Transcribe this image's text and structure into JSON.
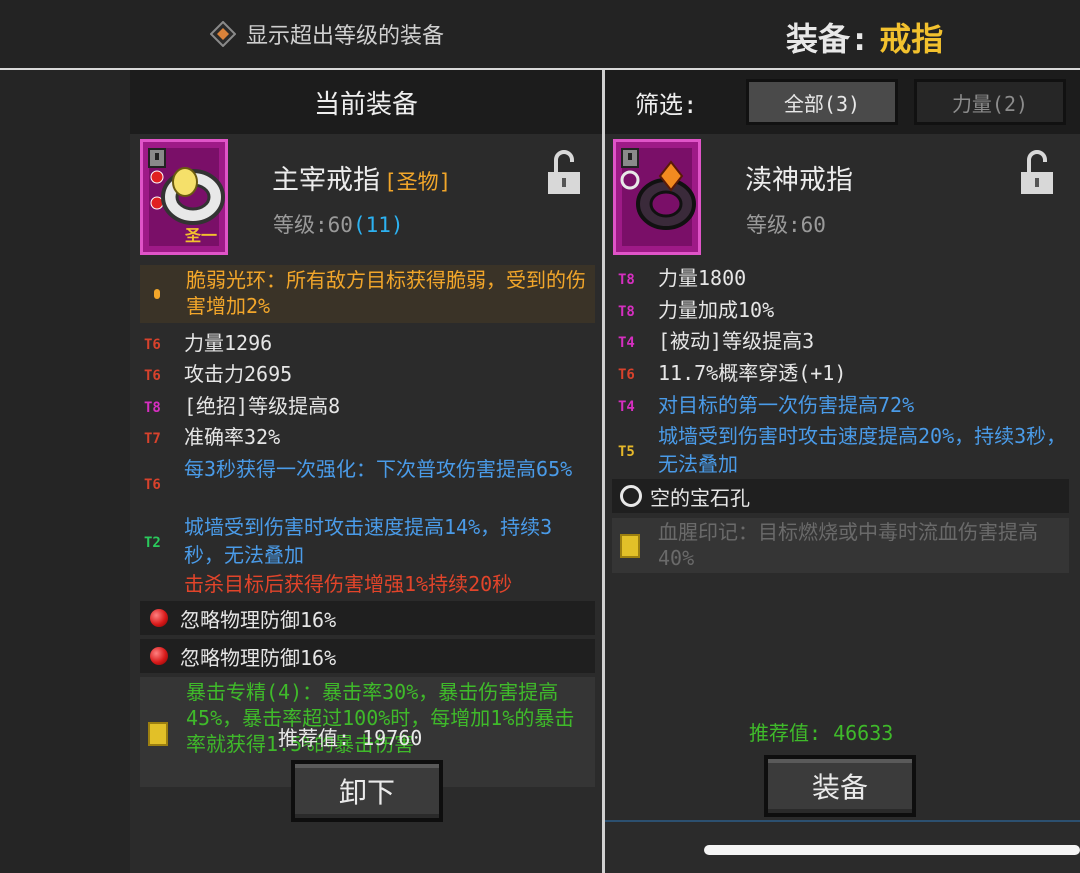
{
  "top": {
    "show_toggle_label": "显示超出等级的装备",
    "equip_label": "装备:",
    "equip_value": "戒指"
  },
  "left": {
    "header": "当前装备",
    "item": {
      "name": "主宰戒指",
      "tag": "[圣物]",
      "icon_badge": "圣一",
      "level_label": "等级:60",
      "level_bonus": "(11)"
    },
    "aura": "脆弱光环：所有敌方目标获得脆弱，受到的伤害增加2%",
    "stats": [
      {
        "tier": "T6",
        "text": "力量1296"
      },
      {
        "tier": "T6",
        "text": "攻击力2695"
      },
      {
        "tier": "T8",
        "text": "[绝招]等级提高8"
      },
      {
        "tier": "T7",
        "text": "准确率32%"
      },
      {
        "tier": "T6",
        "text": "每3秒获得一次强化：下次普攻伤害提高65%"
      },
      {
        "tier": "T2",
        "text": "城墙受到伤害时攻击速度提高14%，持续3秒，无法叠加"
      }
    ],
    "red_line": "击杀目标后获得伤害增强1%持续20秒",
    "gems": [
      "忽略物理防御16%",
      "忽略物理防御16%"
    ],
    "special": "暴击专精(4)：暴击率30%，暴击伤害提高45%，暴击率超过100%时，每增加1%的暴击率就获得1.5%的暴击伤害",
    "recommend_label": "推荐值:",
    "recommend_value": "19760",
    "action_button": "卸下"
  },
  "right": {
    "filter_label": "筛选:",
    "tabs": [
      {
        "label": "全部(3)",
        "active": true
      },
      {
        "label": "力量(2)",
        "active": false
      }
    ],
    "item": {
      "name": "渎神戒指",
      "level_label": "等级:60"
    },
    "stats": [
      {
        "tier": "T8",
        "text": "力量1800"
      },
      {
        "tier": "T8",
        "text": "力量加成10%"
      },
      {
        "tier": "T4",
        "text": "[被动]等级提高3"
      },
      {
        "tier": "T6",
        "text": "11.7%概率穿透(+1)"
      },
      {
        "tier": "T4",
        "text": "对目标的第一次伤害提高72%"
      },
      {
        "tier": "T5",
        "text": "城墙受到伤害时攻击速度提高20%，持续3秒，无法叠加"
      }
    ],
    "gem_slot": "空的宝石孔",
    "special": "血腥印记：目标燃烧或中毒时流血伤害提高40%",
    "recommend_label": "推荐值:",
    "recommend_value": "46633",
    "action_button": "装备"
  },
  "colors": {
    "accent_gold": "#f2c12e",
    "blue_stat": "#4a9be8",
    "green_stat": "#2aca5c",
    "item_frame": "#9e1a87"
  }
}
